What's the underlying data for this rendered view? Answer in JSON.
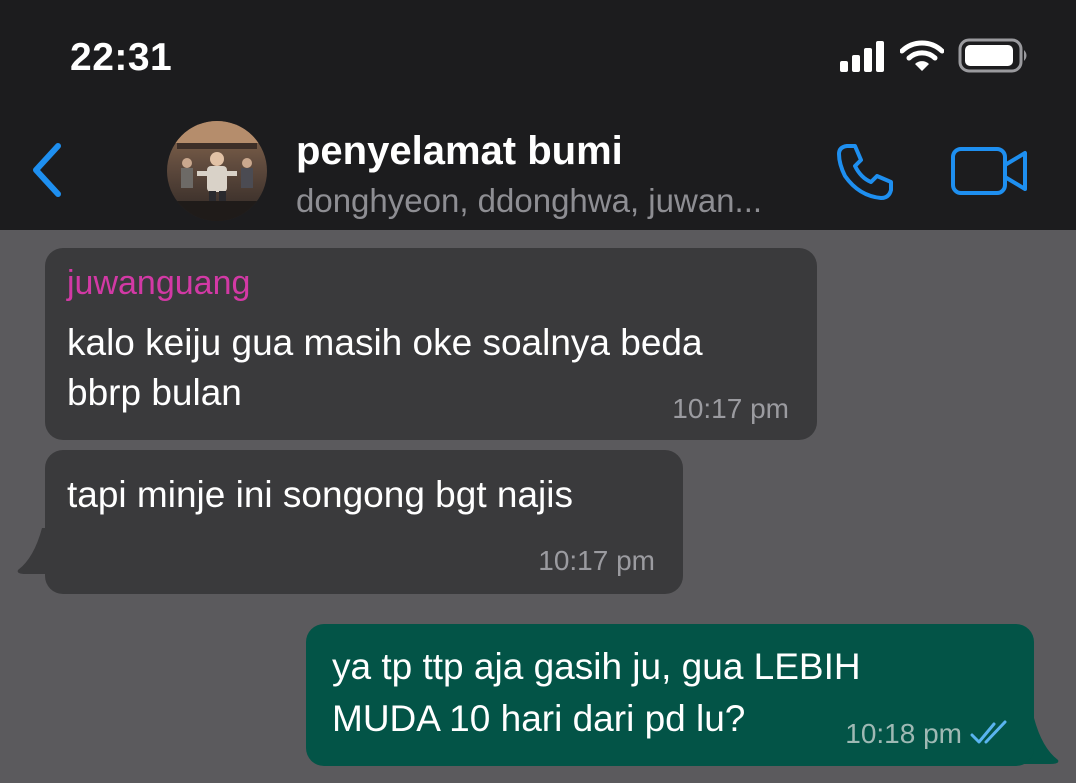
{
  "status_bar": {
    "time": "22:31",
    "icons": [
      "signal-icon",
      "wifi-icon",
      "battery-icon"
    ]
  },
  "header": {
    "back_icon": "chevron-left-icon",
    "title": "penyelamat bumi",
    "subtitle": "donghyeon, ddonghwa, juwan...",
    "call_icon": "phone-icon",
    "video_icon": "video-camera-icon"
  },
  "colors": {
    "accent": "#1e8ff0",
    "incoming_bubble": "#3a3a3c",
    "outgoing_bubble": "#035447",
    "sender_name": "#d239a5",
    "background": "#5b5a5d",
    "read_ticks": "#5ab4f0"
  },
  "messages": [
    {
      "sender": "juwanguang",
      "lines": [
        "kalo keiju gua masih oke soalnya beda",
        "bbrp bulan"
      ],
      "time": "10:17 pm",
      "direction": "incoming"
    },
    {
      "lines": [
        "tapi minje ini songong bgt najis"
      ],
      "time": "10:17 pm",
      "direction": "incoming"
    },
    {
      "lines": [
        "ya tp ttp aja gasih ju, gua LEBIH",
        "MUDA 10 hari dari pd lu?"
      ],
      "time": "10:18 pm",
      "direction": "outgoing",
      "status_icon": "double-check-icon"
    }
  ]
}
